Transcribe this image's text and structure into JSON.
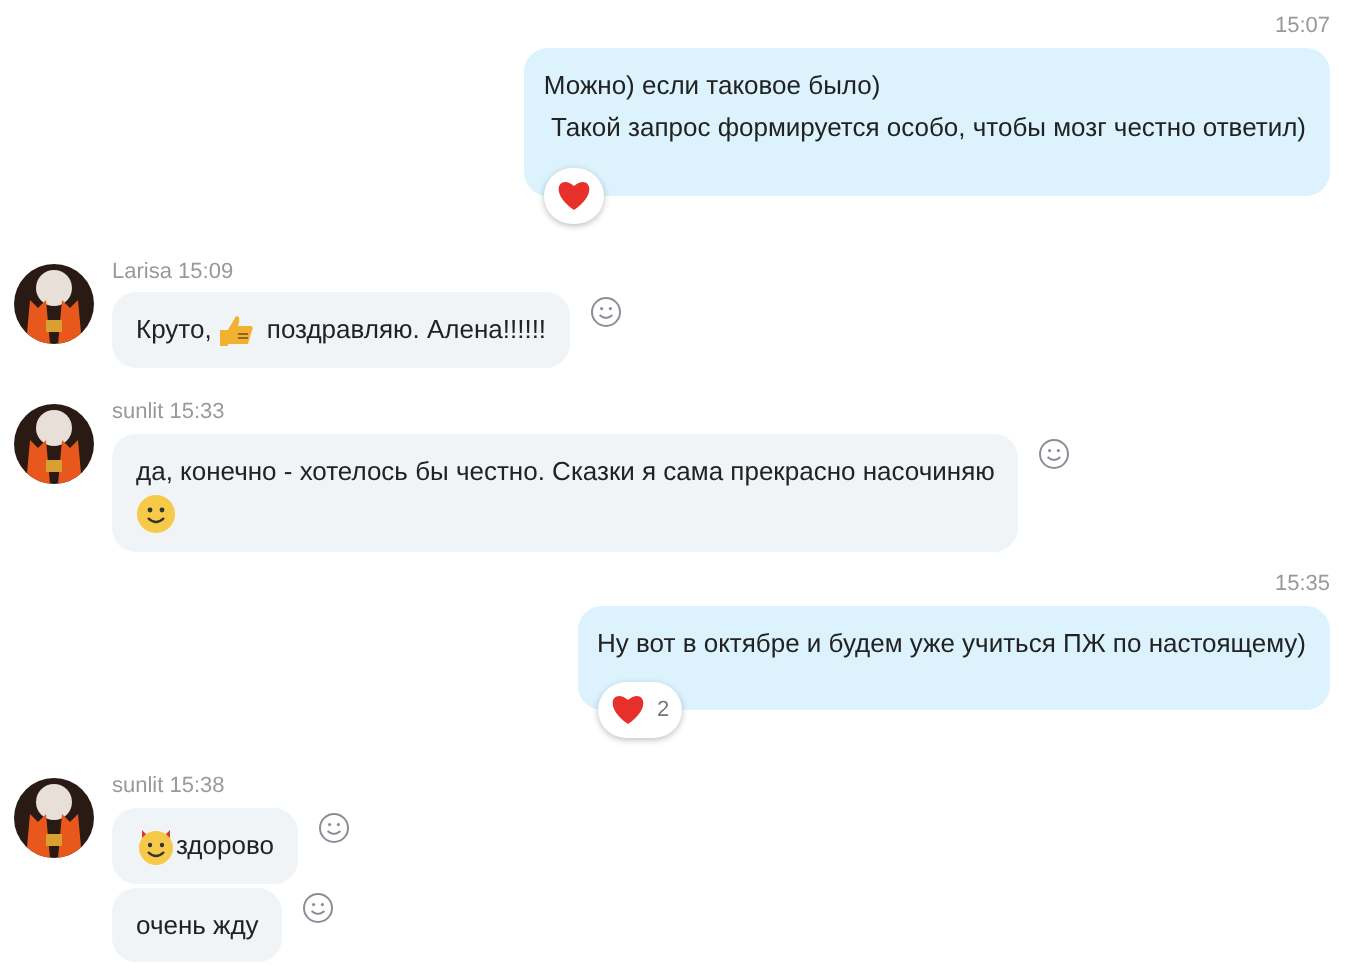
{
  "messages": [
    {
      "kind": "outgoing",
      "time": "15:07",
      "lines": [
        [
          {
            "kind": "text",
            "text": "Можно) если таковое было)"
          }
        ],
        [
          {
            "kind": "text",
            "text": " Такой запрос формируется особо, чтобы мозг честно ответил)"
          }
        ]
      ],
      "reaction": {
        "kind": "heart"
      }
    },
    {
      "kind": "incoming",
      "sender": "Larisa",
      "time": "15:09",
      "bubbles": [
        {
          "lines": [
            [
              {
                "kind": "text",
                "text": "Круто,"
              },
              {
                "kind": "thumbs_up"
              },
              {
                "kind": "text",
                "text": " поздравляю. Алена!!!!!!"
              }
            ]
          ]
        }
      ]
    },
    {
      "kind": "incoming",
      "sender": "sunlit",
      "time": "15:33",
      "bubbles": [
        {
          "lines": [
            [
              {
                "kind": "text",
                "text": "да, конечно - хотелось бы честно. Сказки я сама прекрасно насочиняю"
              }
            ],
            [
              {
                "kind": "smile"
              }
            ]
          ]
        }
      ]
    },
    {
      "kind": "outgoing",
      "time": "15:35",
      "lines": [
        [
          {
            "kind": "text",
            "text": "Ну вот в октябре и будем уже учиться ПЖ по настоящему)"
          }
        ]
      ],
      "reaction": {
        "kind": "heart",
        "count": "2"
      }
    },
    {
      "kind": "incoming",
      "sender": "sunlit",
      "time": "15:38",
      "bubbles": [
        {
          "lines": [
            [
              {
                "kind": "horned_smile"
              },
              {
                "kind": "text",
                "text": "здорово"
              }
            ]
          ]
        },
        {
          "lines": [
            [
              {
                "kind": "text",
                "text": "очень жду"
              }
            ]
          ]
        }
      ]
    }
  ]
}
